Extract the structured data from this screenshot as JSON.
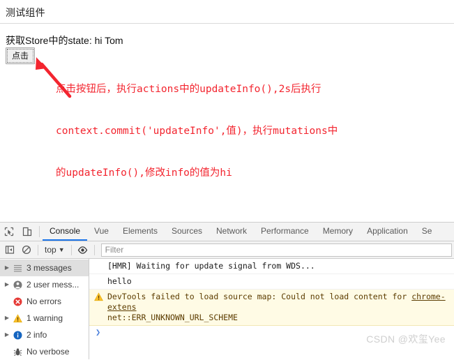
{
  "page": {
    "title": "测试组件",
    "state_line": "获取Store中的state: hi Tom",
    "button_label": "点击",
    "annotation_lines": [
      "点击按钮后，执行actions中的updateInfo(),2s后执行",
      "context.commit('updateInfo',值)，执行mutations中",
      "的updateInfo(),修改info的值为hi"
    ],
    "annotation_color": "#f3252f"
  },
  "devtools": {
    "tabs": [
      {
        "label": "Console",
        "active": true
      },
      {
        "label": "Vue",
        "active": false
      },
      {
        "label": "Elements",
        "active": false
      },
      {
        "label": "Sources",
        "active": false
      },
      {
        "label": "Network",
        "active": false
      },
      {
        "label": "Performance",
        "active": false
      },
      {
        "label": "Memory",
        "active": false
      },
      {
        "label": "Application",
        "active": false
      },
      {
        "label": "Se",
        "active": false
      }
    ],
    "active_tab_color": "#1a73e8",
    "toolbar": {
      "inspect_icon": "inspect-element-icon",
      "device_icon": "device-toolbar-icon"
    },
    "filter_bar": {
      "sidebar_toggle_icon": "console-sidebar-toggle-icon",
      "clear_icon": "clear-console-icon",
      "context": "top",
      "context_caret": "▼",
      "eye_icon": "live-expression-eye-icon",
      "filter_placeholder": "Filter",
      "filter_value": ""
    },
    "sidebar": [
      {
        "label": "3 messages",
        "icon": "list-icon",
        "expandable": true,
        "selected": true
      },
      {
        "label": "2 user mess...",
        "icon": "user-icon",
        "expandable": true,
        "selected": false
      },
      {
        "label": "No errors",
        "icon": "error-icon",
        "expandable": false,
        "selected": false
      },
      {
        "label": "1 warning",
        "icon": "warning-icon",
        "expandable": true,
        "selected": false
      },
      {
        "label": "2 info",
        "icon": "info-icon",
        "expandable": true,
        "selected": false
      },
      {
        "label": "No verbose",
        "icon": "verbose-bug-icon",
        "expandable": false,
        "selected": false
      }
    ],
    "messages": [
      {
        "level": "info",
        "text": "[HMR] Waiting for update signal from WDS..."
      },
      {
        "level": "log",
        "text": "hello"
      },
      {
        "level": "warning",
        "icon": "warning-triangle-icon",
        "text_before": "DevTools failed to load source map: Could not load content for ",
        "link": "chrome-extens",
        "text_after": "net::ERR_UNKNOWN_URL_SCHEME"
      }
    ],
    "prompt_caret": "❯"
  },
  "watermark": "CSDN @欢玺Yee"
}
